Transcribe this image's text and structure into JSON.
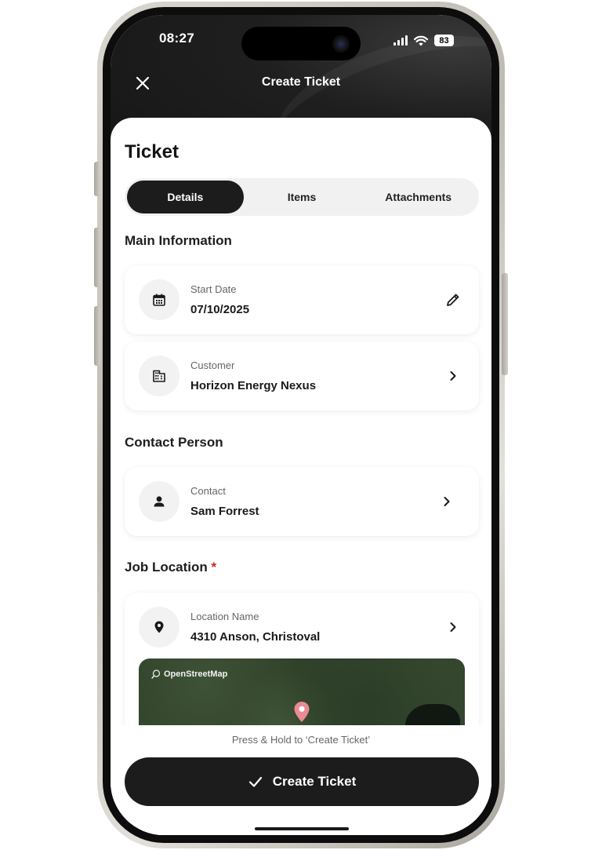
{
  "status_bar": {
    "time": "08:27",
    "battery": "83"
  },
  "header": {
    "title": "Create Ticket"
  },
  "page": {
    "title": "Ticket"
  },
  "tabs": [
    {
      "label": "Details",
      "active": true
    },
    {
      "label": "Items",
      "active": false
    },
    {
      "label": "Attachments",
      "active": false
    }
  ],
  "main_information": {
    "title": "Main Information",
    "start_date": {
      "label": "Start Date",
      "value": "07/10/2025"
    },
    "customer": {
      "label": "Customer",
      "value": "Horizon Energy Nexus"
    }
  },
  "contact_person": {
    "title": "Contact Person",
    "contact": {
      "label": "Contact",
      "value": "Sam Forrest"
    }
  },
  "job_location": {
    "title": "Job Location",
    "required_mark": "*",
    "location": {
      "label": "Location Name",
      "value": "4310 Anson, Christoval"
    },
    "map_attribution": "OpenStreetMap"
  },
  "footer": {
    "hint": "Press & Hold to ‘Create Ticket’",
    "button_label": "Create Ticket"
  },
  "colors": {
    "primary": "#1c1c1c",
    "required": "#c62828",
    "map_pin": "#ea8a94"
  }
}
